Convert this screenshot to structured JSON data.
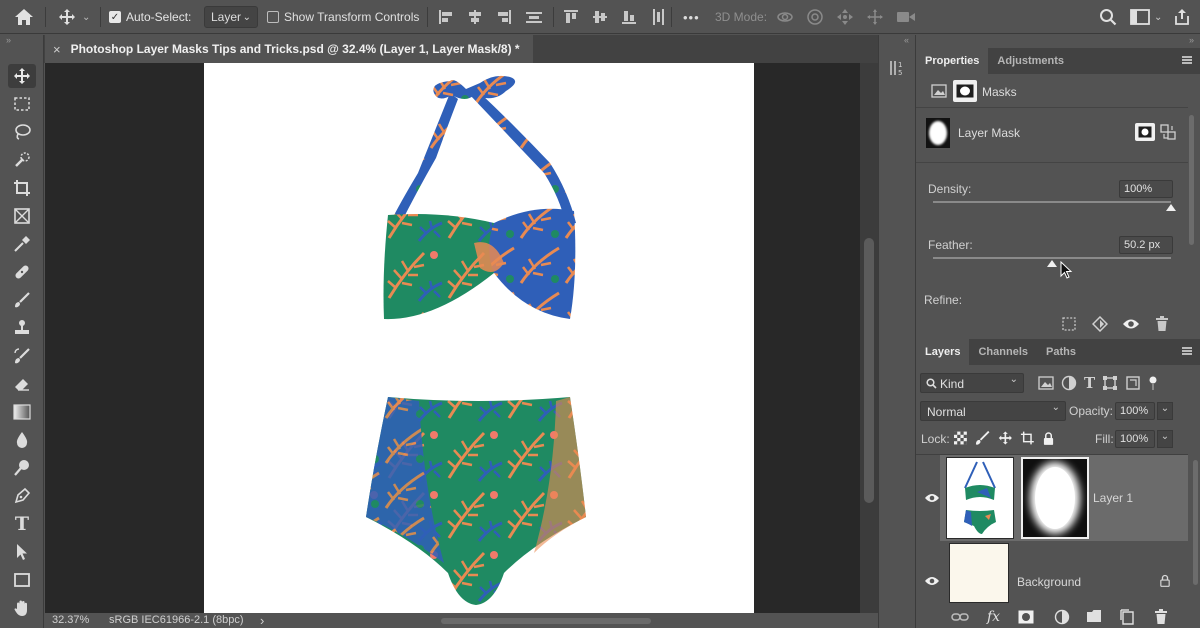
{
  "options_bar": {
    "auto_select_label": "Auto-Select:",
    "auto_select_value": "Layer",
    "show_transform_label": "Show Transform Controls",
    "mode_3d_label": "3D Mode:",
    "more_label": "•••"
  },
  "document": {
    "tab_title": "Photoshop Layer Masks Tips and Tricks.psd @ 32.4% (Layer 1, Layer Mask/8) *",
    "close_glyph": "×"
  },
  "status": {
    "zoom": "32.37%",
    "profile": "sRGB IEC61966-2.1 (8bpc)",
    "arrow": "›"
  },
  "properties": {
    "tabs": [
      "Properties",
      "Adjustments"
    ],
    "masks_label": "Masks",
    "layer_mask_label": "Layer Mask",
    "density_label": "Density:",
    "density_value": "100%",
    "density_level": 1.0,
    "feather_label": "Feather:",
    "feather_value": "50.2 px",
    "feather_level": 0.5,
    "refine_label": "Refine:"
  },
  "layers": {
    "tabs": [
      "Layers",
      "Channels",
      "Paths"
    ],
    "filter_kind": "Kind",
    "blend_mode": "Normal",
    "opacity_label": "Opacity:",
    "opacity_value": "100%",
    "lock_label": "Lock:",
    "fill_label": "Fill:",
    "fill_value": "100%",
    "items": [
      {
        "name": "Layer 1",
        "selected": true
      },
      {
        "name": "Background",
        "selected": false
      }
    ],
    "footer_fx": "fx"
  },
  "colors": {
    "accent_selected": "#6b6b6b",
    "bikini_green": "#1f8a62",
    "bikini_orange": "#e98a52",
    "bikini_blue": "#2f5fb8"
  }
}
